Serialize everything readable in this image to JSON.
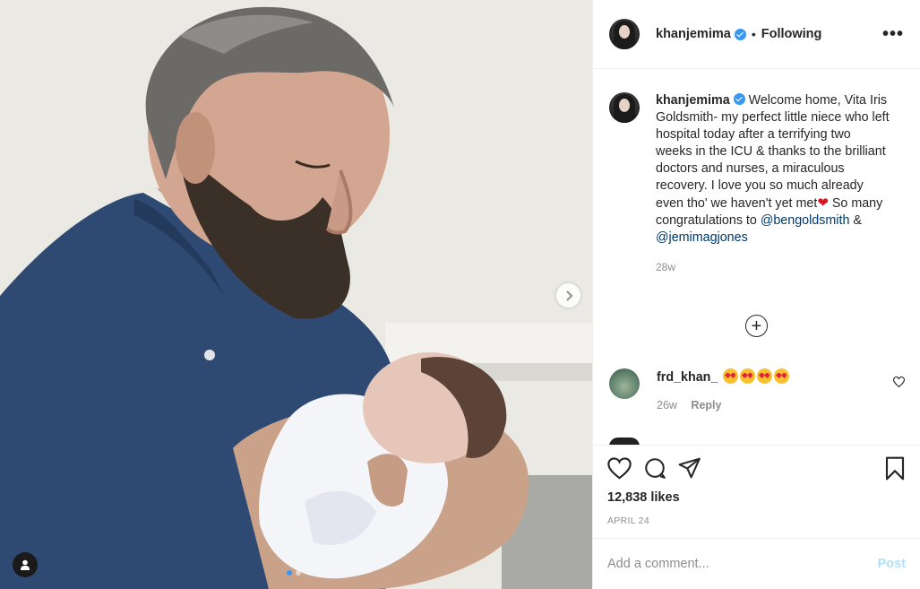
{
  "post": {
    "image_alt": "man holding a newborn baby",
    "carousel": {
      "dots": 2,
      "active": 0
    }
  },
  "header": {
    "username": "khanjemima",
    "separator": "•",
    "follow_status": "Following",
    "more_label": "•••"
  },
  "caption": {
    "username": "khanjemima",
    "text_1": "Welcome home, Vita Iris Goldsmith- my perfect little niece who left hospital today after a terrifying two weeks in the ICU & thanks to the brilliant doctors and nurses, a miraculous recovery. I love you so much already even tho' we haven't yet met",
    "emoji": "❤",
    "text_2": " So many congratulations to ",
    "mention_1": "@bengoldsmith",
    "text_3": " & ",
    "mention_2": "@jemimagjones",
    "time": "28w"
  },
  "load_more_label": "+",
  "comment": {
    "username": "frd_khan_",
    "emoji_count": 4,
    "time": "26w",
    "reply_label": "Reply"
  },
  "likes": "12,838 likes",
  "date": "APRIL 24",
  "add_comment": {
    "placeholder": "Add a comment...",
    "post_label": "Post"
  },
  "colors": {
    "accent": "#3897f0",
    "mention": "#00376b",
    "post_disabled": "#b2dffc"
  }
}
